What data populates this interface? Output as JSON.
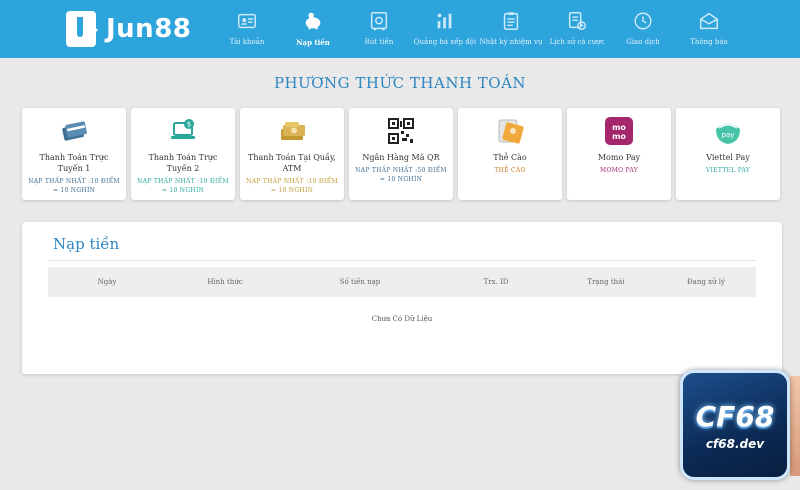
{
  "header": {
    "logo_text": "Jun88",
    "nav": [
      {
        "label": "Tài khoản",
        "icon": "id-card-icon",
        "active": false
      },
      {
        "label": "Nạp tiền",
        "icon": "piggy-bank-icon",
        "active": true
      },
      {
        "label": "Rút tiền",
        "icon": "safe-icon",
        "active": false
      },
      {
        "label": "Quảng bá xếp đội",
        "icon": "chart-user-icon",
        "active": false
      },
      {
        "label": "Nhật ký nhiệm vụ",
        "icon": "clipboard-icon",
        "active": false
      },
      {
        "label": "Lịch sử cá cược",
        "icon": "history-doc-icon",
        "active": false
      },
      {
        "label": "Giao dịch",
        "icon": "clock-icon",
        "active": false
      },
      {
        "label": "Thông báo",
        "icon": "envelope-icon",
        "active": false
      }
    ]
  },
  "section_title": "PHƯƠNG THỨC THANH TOÁN",
  "payment_methods": [
    {
      "name": "Thanh Toán Trực Tuyến 1",
      "min": "NẠP THẤP NHẤT :10 ĐIỂM = 10 NGHÌN",
      "icon": "card-payment-icon",
      "color": "#3d6e93"
    },
    {
      "name": "Thanh Toán Trực Tuyến 2",
      "min": "NẠP THẤP NHẤT :10 ĐIỂM = 10 NGHÌN",
      "icon": "laptop-payment-icon",
      "color": "#2aa79b"
    },
    {
      "name": "Thanh Toán Tại Quầy, ATM",
      "min": "NẠP THẤP NHẤT :10 ĐIỂM = 10 NGHÌN",
      "icon": "cash-icon",
      "color": "#c39a33"
    },
    {
      "name": "Ngân Hàng Mã QR",
      "min": "NẠP THẤP NHẤT :50 ĐIỂM = 10 NGHÌN",
      "icon": "qr-code-icon",
      "color": "#3d6e93"
    },
    {
      "name": "Thẻ Cào",
      "min": "THẺ CÀO",
      "icon": "scratch-card-icon",
      "color": "#c9771e"
    },
    {
      "name": "Momo Pay",
      "min": "MOMO PAY",
      "icon": "momo-icon",
      "color": "#a5276b"
    },
    {
      "name": "Viettel Pay",
      "min": "VIETTEL PAY",
      "icon": "viettel-pay-icon",
      "color": "#2aa79b"
    }
  ],
  "deposit": {
    "title": "Nạp tiền",
    "columns": [
      "Ngày",
      "Hình thức",
      "Số tiền nạp",
      "Trx. ID",
      "Trạng thái",
      "Đang xử lý"
    ],
    "empty_text": "Chưa Có Dữ Liệu"
  },
  "watermark": {
    "logo": "CF68",
    "url": "cf68.dev"
  }
}
